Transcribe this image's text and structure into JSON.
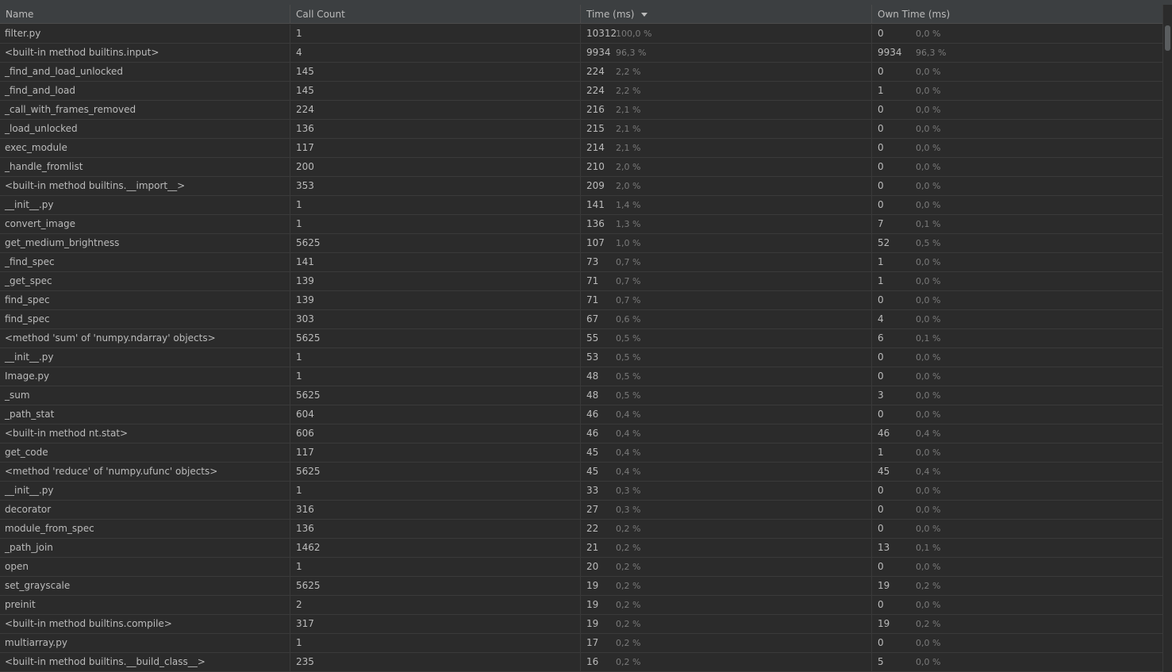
{
  "columns": {
    "name": "Name",
    "call_count": "Call Count",
    "time": "Time (ms)",
    "own_time": "Own Time (ms)"
  },
  "sort": {
    "column": "time",
    "direction": "descending",
    "icon": "sort-descending-icon"
  },
  "rows": [
    {
      "name": "filter.py",
      "count": "1",
      "time": "10312",
      "time_pct": "100,0 %",
      "own": "0",
      "own_pct": "0,0 %"
    },
    {
      "name": "<built-in method builtins.input>",
      "count": "4",
      "time": "9934",
      "time_pct": "96,3 %",
      "own": "9934",
      "own_pct": "96,3 %"
    },
    {
      "name": "_find_and_load_unlocked",
      "count": "145",
      "time": "224",
      "time_pct": "2,2 %",
      "own": "0",
      "own_pct": "0,0 %"
    },
    {
      "name": "_find_and_load",
      "count": "145",
      "time": "224",
      "time_pct": "2,2 %",
      "own": "1",
      "own_pct": "0,0 %"
    },
    {
      "name": "_call_with_frames_removed",
      "count": "224",
      "time": "216",
      "time_pct": "2,1 %",
      "own": "0",
      "own_pct": "0,0 %"
    },
    {
      "name": "_load_unlocked",
      "count": "136",
      "time": "215",
      "time_pct": "2,1 %",
      "own": "0",
      "own_pct": "0,0 %"
    },
    {
      "name": "exec_module",
      "count": "117",
      "time": "214",
      "time_pct": "2,1 %",
      "own": "0",
      "own_pct": "0,0 %"
    },
    {
      "name": "_handle_fromlist",
      "count": "200",
      "time": "210",
      "time_pct": "2,0 %",
      "own": "0",
      "own_pct": "0,0 %"
    },
    {
      "name": "<built-in method builtins.__import__>",
      "count": "353",
      "time": "209",
      "time_pct": "2,0 %",
      "own": "0",
      "own_pct": "0,0 %"
    },
    {
      "name": "__init__.py",
      "count": "1",
      "time": "141",
      "time_pct": "1,4 %",
      "own": "0",
      "own_pct": "0,0 %"
    },
    {
      "name": "convert_image",
      "count": "1",
      "time": "136",
      "time_pct": "1,3 %",
      "own": "7",
      "own_pct": "0,1 %"
    },
    {
      "name": "get_medium_brightness",
      "count": "5625",
      "time": "107",
      "time_pct": "1,0 %",
      "own": "52",
      "own_pct": "0,5 %"
    },
    {
      "name": "_find_spec",
      "count": "141",
      "time": "73",
      "time_pct": "0,7 %",
      "own": "1",
      "own_pct": "0,0 %"
    },
    {
      "name": "_get_spec",
      "count": "139",
      "time": "71",
      "time_pct": "0,7 %",
      "own": "1",
      "own_pct": "0,0 %"
    },
    {
      "name": "find_spec",
      "count": "139",
      "time": "71",
      "time_pct": "0,7 %",
      "own": "0",
      "own_pct": "0,0 %"
    },
    {
      "name": "find_spec",
      "count": "303",
      "time": "67",
      "time_pct": "0,6 %",
      "own": "4",
      "own_pct": "0,0 %"
    },
    {
      "name": "<method 'sum' of 'numpy.ndarray' objects>",
      "count": "5625",
      "time": "55",
      "time_pct": "0,5 %",
      "own": "6",
      "own_pct": "0,1 %"
    },
    {
      "name": "__init__.py",
      "count": "1",
      "time": "53",
      "time_pct": "0,5 %",
      "own": "0",
      "own_pct": "0,0 %"
    },
    {
      "name": "Image.py",
      "count": "1",
      "time": "48",
      "time_pct": "0,5 %",
      "own": "0",
      "own_pct": "0,0 %"
    },
    {
      "name": "_sum",
      "count": "5625",
      "time": "48",
      "time_pct": "0,5 %",
      "own": "3",
      "own_pct": "0,0 %"
    },
    {
      "name": "_path_stat",
      "count": "604",
      "time": "46",
      "time_pct": "0,4 %",
      "own": "0",
      "own_pct": "0,0 %"
    },
    {
      "name": "<built-in method nt.stat>",
      "count": "606",
      "time": "46",
      "time_pct": "0,4 %",
      "own": "46",
      "own_pct": "0,4 %"
    },
    {
      "name": "get_code",
      "count": "117",
      "time": "45",
      "time_pct": "0,4 %",
      "own": "1",
      "own_pct": "0,0 %"
    },
    {
      "name": "<method 'reduce' of 'numpy.ufunc' objects>",
      "count": "5625",
      "time": "45",
      "time_pct": "0,4 %",
      "own": "45",
      "own_pct": "0,4 %"
    },
    {
      "name": "__init__.py",
      "count": "1",
      "time": "33",
      "time_pct": "0,3 %",
      "own": "0",
      "own_pct": "0,0 %"
    },
    {
      "name": "decorator",
      "count": "316",
      "time": "27",
      "time_pct": "0,3 %",
      "own": "0",
      "own_pct": "0,0 %"
    },
    {
      "name": "module_from_spec",
      "count": "136",
      "time": "22",
      "time_pct": "0,2 %",
      "own": "0",
      "own_pct": "0,0 %"
    },
    {
      "name": "_path_join",
      "count": "1462",
      "time": "21",
      "time_pct": "0,2 %",
      "own": "13",
      "own_pct": "0,1 %"
    },
    {
      "name": "open",
      "count": "1",
      "time": "20",
      "time_pct": "0,2 %",
      "own": "0",
      "own_pct": "0,0 %"
    },
    {
      "name": "set_grayscale",
      "count": "5625",
      "time": "19",
      "time_pct": "0,2 %",
      "own": "19",
      "own_pct": "0,2 %"
    },
    {
      "name": "preinit",
      "count": "2",
      "time": "19",
      "time_pct": "0,2 %",
      "own": "0",
      "own_pct": "0,0 %"
    },
    {
      "name": "<built-in method builtins.compile>",
      "count": "317",
      "time": "19",
      "time_pct": "0,2 %",
      "own": "19",
      "own_pct": "0,2 %"
    },
    {
      "name": "multiarray.py",
      "count": "1",
      "time": "17",
      "time_pct": "0,2 %",
      "own": "0",
      "own_pct": "0,0 %"
    },
    {
      "name": "<built-in method builtins.__build_class__>",
      "count": "235",
      "time": "16",
      "time_pct": "0,2 %",
      "own": "5",
      "own_pct": "0,0 %"
    }
  ]
}
